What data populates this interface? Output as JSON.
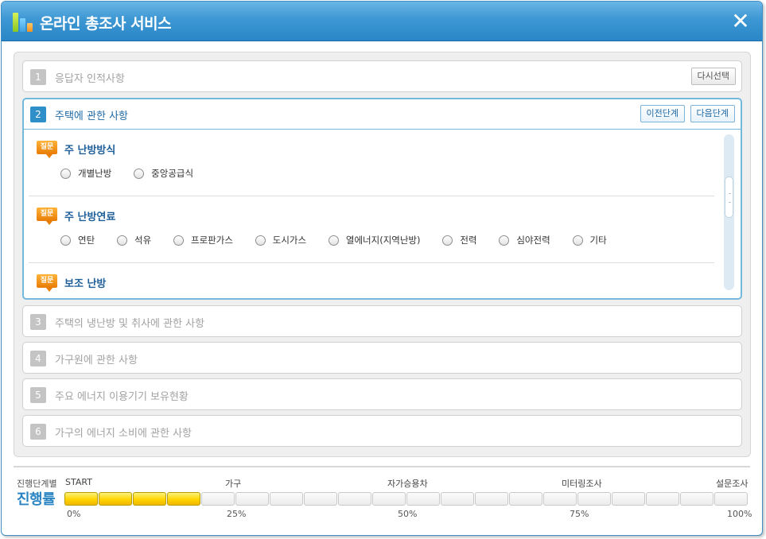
{
  "window": {
    "title": "온라인 총조사 서비스",
    "close_icon": "close-icon",
    "logo_icon": "bar-chart-logo-icon"
  },
  "sections": [
    {
      "num": "1",
      "title": "응답자 인적사항",
      "state": "completed",
      "buttons": [
        "다시선택"
      ]
    },
    {
      "num": "2",
      "title": "주택에 관한 사항",
      "state": "active",
      "buttons": [
        "이전단계",
        "다음단계"
      ]
    },
    {
      "num": "3",
      "title": "주택의 냉난방 및 취사에 관한 사항",
      "state": "pending"
    },
    {
      "num": "4",
      "title": "가구원에 관한 사항",
      "state": "pending"
    },
    {
      "num": "5",
      "title": "주요 에너지 이용기기 보유현황",
      "state": "pending"
    },
    {
      "num": "6",
      "title": "가구의 에너지 소비에 관한 사항",
      "state": "pending"
    }
  ],
  "questions": [
    {
      "badge": "질문",
      "title": "주 난방방식",
      "options": [
        "개별난방",
        "중앙공급식"
      ]
    },
    {
      "badge": "질문",
      "title": "주 난방연료",
      "options": [
        "연탄",
        "석유",
        "프로판가스",
        "도시가스",
        "열에너지(지역난방)",
        "전력",
        "심야전력",
        "기타"
      ]
    },
    {
      "badge": "질문",
      "title": "보조 난방",
      "options": []
    }
  ],
  "progress": {
    "caption": "진행단계별",
    "title": "진행률",
    "stages": [
      "START",
      "가구",
      "자가승용차",
      "미터링조사",
      "설문조사"
    ],
    "percent_labels": [
      "0%",
      "25%",
      "50%",
      "75%",
      "100%"
    ],
    "total_segments": 20,
    "completed_segments": 4,
    "done_color": "#ffd400",
    "accent_color": "#2a84c2"
  }
}
